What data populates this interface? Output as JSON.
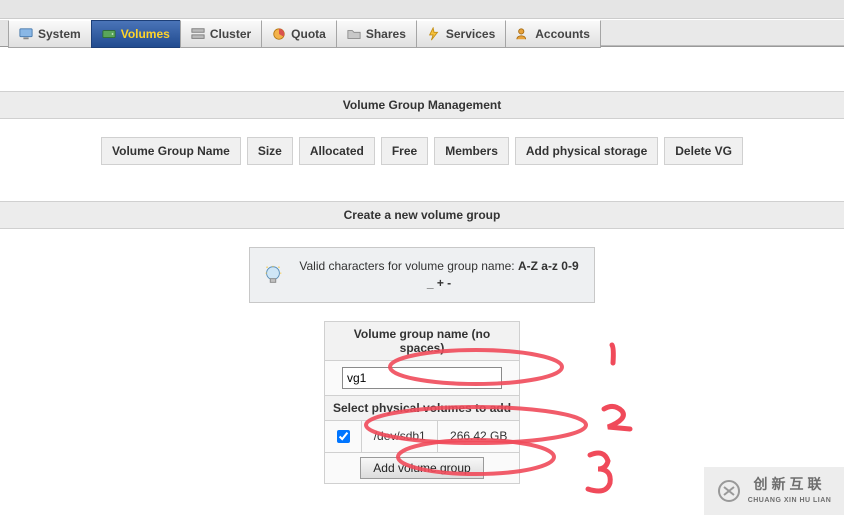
{
  "nav": {
    "items": [
      {
        "label": "System",
        "active": false,
        "icon": "monitor"
      },
      {
        "label": "Volumes",
        "active": true,
        "icon": "drive"
      },
      {
        "label": "Cluster",
        "active": false,
        "icon": "servers"
      },
      {
        "label": "Quota",
        "active": false,
        "icon": "pie"
      },
      {
        "label": "Shares",
        "active": false,
        "icon": "folder"
      },
      {
        "label": "Services",
        "active": false,
        "icon": "bolt"
      },
      {
        "label": "Accounts",
        "active": false,
        "icon": "users"
      }
    ]
  },
  "section1_title": "Volume Group Management",
  "columns": [
    "Volume Group Name",
    "Size",
    "Allocated",
    "Free",
    "Members",
    "Add physical storage",
    "Delete VG"
  ],
  "section2_title": "Create a new volume group",
  "info": {
    "prefix": "Valid characters for volume group name: ",
    "bold": "A-Z a-z 0-9 _ + -"
  },
  "form": {
    "name_header": "Volume group name (no spaces)",
    "name_value": "vg1",
    "pv_header": "Select physical volumes to add",
    "pv_rows": [
      {
        "checked": true,
        "device": "/dev/sdb1",
        "size": "266.42 GB"
      }
    ],
    "submit_label": "Add volume group"
  },
  "annotations": {
    "one": "1",
    "two": "2",
    "three": "3"
  },
  "watermark": {
    "cn": "创新互联",
    "py": "CHUANG XIN HU LIAN"
  }
}
